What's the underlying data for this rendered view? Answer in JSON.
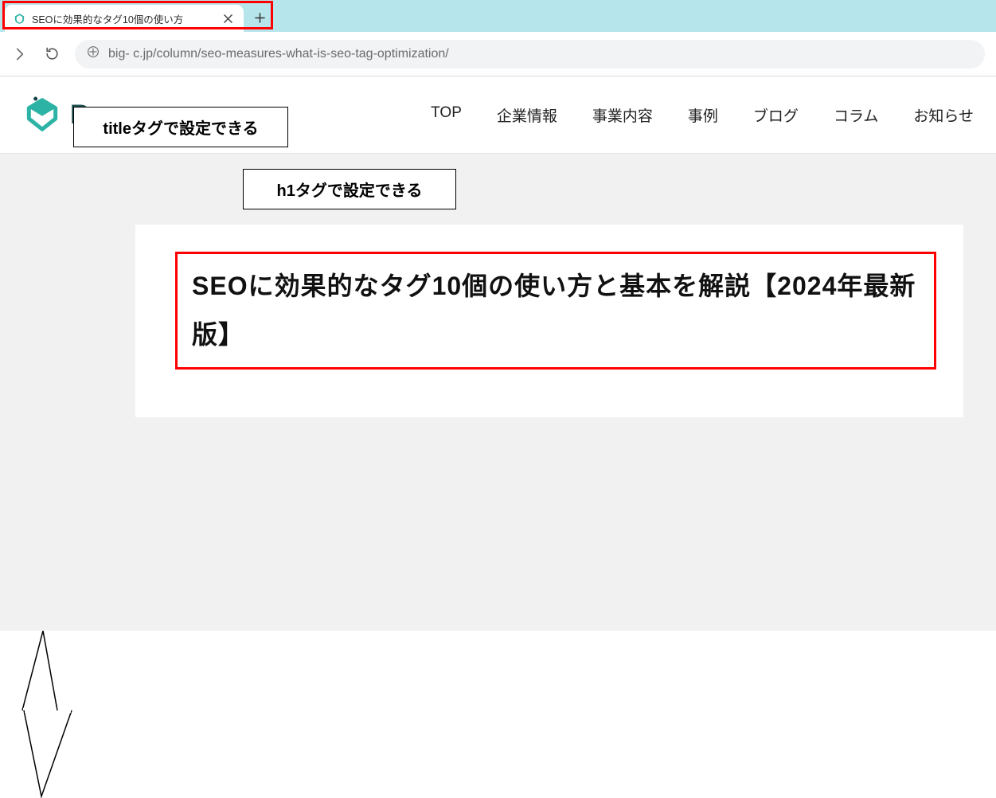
{
  "browser": {
    "tab": {
      "title": "SEOに効果的なタグ10個の使い方"
    },
    "url": "big-   c.jp/column/seo-measures-what-is-seo-tag-optimization/"
  },
  "site": {
    "brand": "B",
    "nav": {
      "top": "TOP",
      "company": "企業情報",
      "business": "事業内容",
      "cases": "事例",
      "blog": "ブログ",
      "column": "コラム",
      "news": "お知らせ"
    }
  },
  "article": {
    "h1": "SEOに効果的なタグ10個の使い方と基本を解説【2024年最新版】"
  },
  "callout": {
    "title_tag": "titleタグで設定できる",
    "h1_tag": "h1タグで設定できる"
  }
}
